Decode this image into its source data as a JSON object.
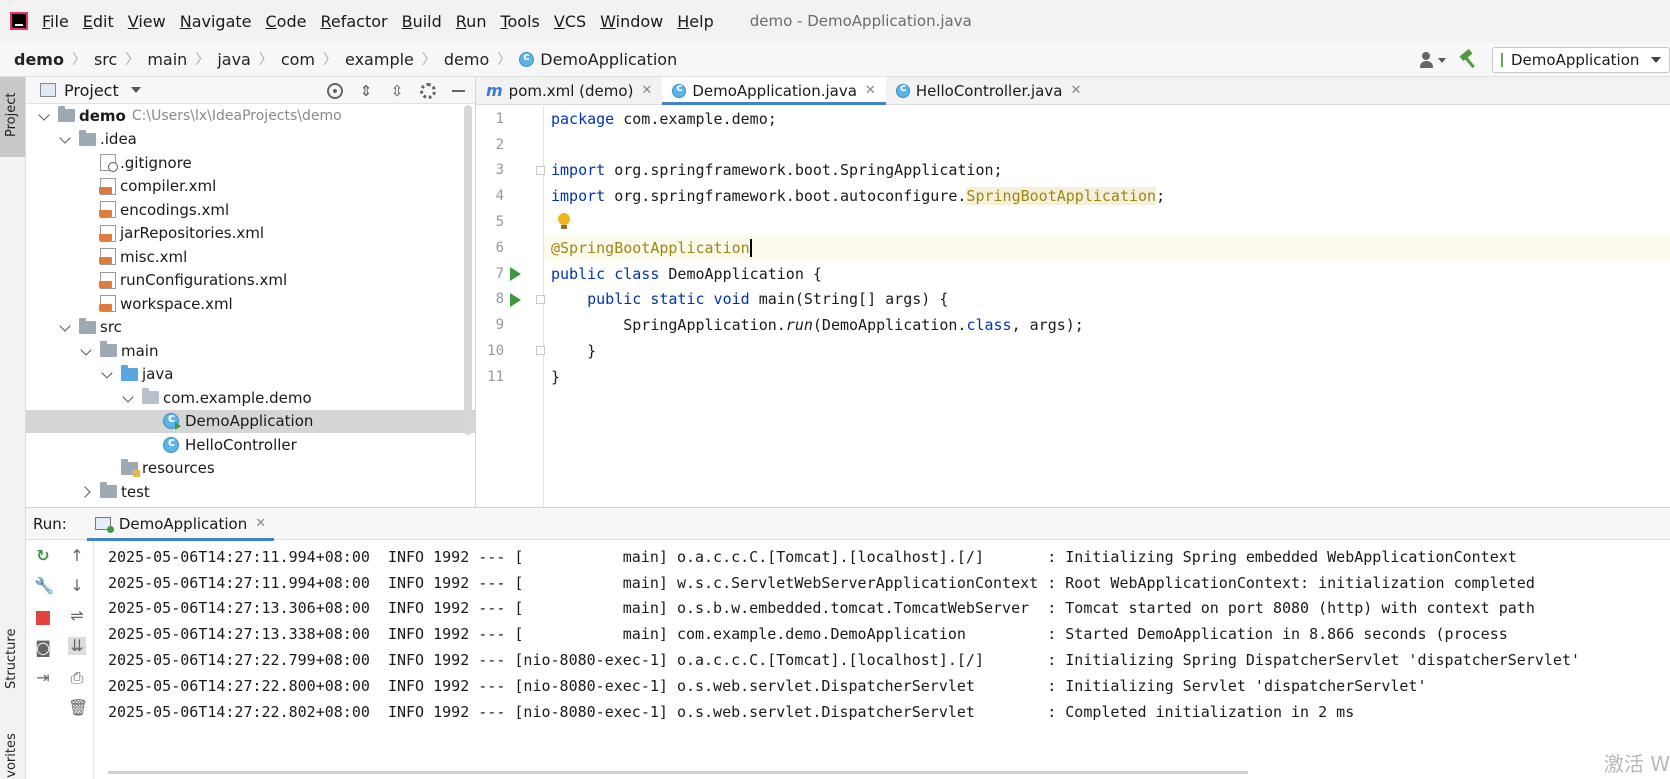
{
  "menubar": {
    "items": [
      {
        "label": "File",
        "ul": "F",
        "rest": "ile"
      },
      {
        "label": "Edit",
        "ul": "E",
        "rest": "dit"
      },
      {
        "label": "View",
        "ul": "V",
        "rest": "iew"
      },
      {
        "label": "Navigate",
        "ul": "N",
        "rest": "avigate"
      },
      {
        "label": "Code",
        "ul": "C",
        "rest": "ode"
      },
      {
        "label": "Refactor",
        "ul": "R",
        "rest": "efactor"
      },
      {
        "label": "Build",
        "ul": "B",
        "rest": "uild"
      },
      {
        "label": "Run",
        "ul": "R",
        "rest": "un"
      },
      {
        "label": "Tools",
        "ul": "T",
        "rest": "ools"
      },
      {
        "label": "VCS",
        "ul": "V",
        "rest": "CS"
      },
      {
        "label": "Window",
        "ul": "W",
        "rest": "indow"
      },
      {
        "label": "Help",
        "ul": "H",
        "rest": "elp"
      }
    ],
    "window_title": "demo - DemoApplication.java"
  },
  "breadcrumb": [
    "demo",
    "src",
    "main",
    "java",
    "com",
    "example",
    "demo",
    "DemoApplication"
  ],
  "run_config": {
    "label": "DemoApplication"
  },
  "left_strip": {
    "project": "Project",
    "structure": "Structure",
    "favorites": "Favorites"
  },
  "project_panel": {
    "title": "Project",
    "tree": [
      {
        "label": "demo",
        "path": "C:\\Users\\lx\\IdeaProjects\\demo",
        "depth": 0,
        "chev": "down",
        "icon": "folder",
        "bold": true
      },
      {
        "label": ".idea",
        "depth": 1,
        "chev": "down",
        "icon": "folder"
      },
      {
        "label": ".gitignore",
        "depth": 2,
        "chev": "none",
        "icon": "git"
      },
      {
        "label": "compiler.xml",
        "depth": 2,
        "chev": "none",
        "icon": "xml"
      },
      {
        "label": "encodings.xml",
        "depth": 2,
        "chev": "none",
        "icon": "xml"
      },
      {
        "label": "jarRepositories.xml",
        "depth": 2,
        "chev": "none",
        "icon": "xml"
      },
      {
        "label": "misc.xml",
        "depth": 2,
        "chev": "none",
        "icon": "xml"
      },
      {
        "label": "runConfigurations.xml",
        "depth": 2,
        "chev": "none",
        "icon": "xml"
      },
      {
        "label": "workspace.xml",
        "depth": 2,
        "chev": "none",
        "icon": "xml"
      },
      {
        "label": "src",
        "depth": 1,
        "chev": "down",
        "icon": "folder"
      },
      {
        "label": "main",
        "depth": 2,
        "chev": "down",
        "icon": "folder"
      },
      {
        "label": "java",
        "depth": 3,
        "chev": "down",
        "icon": "folder-blue"
      },
      {
        "label": "com.example.demo",
        "depth": 4,
        "chev": "down",
        "icon": "package"
      },
      {
        "label": "DemoApplication",
        "depth": 5,
        "chev": "none",
        "icon": "class-run",
        "selected": true
      },
      {
        "label": "HelloController",
        "depth": 5,
        "chev": "none",
        "icon": "class"
      },
      {
        "label": "resources",
        "depth": 3,
        "chev": "none",
        "icon": "resources"
      },
      {
        "label": "test",
        "depth": 2,
        "chev": "right",
        "icon": "folder"
      }
    ]
  },
  "editor": {
    "tabs": [
      {
        "label": "pom.xml (demo)",
        "icon": "maven",
        "active": false
      },
      {
        "label": "DemoApplication.java",
        "icon": "class",
        "active": true
      },
      {
        "label": "HelloController.java",
        "icon": "class",
        "active": false
      }
    ],
    "line_numbers": [
      "1",
      "2",
      "3",
      "4",
      "5",
      "6",
      "7",
      "8",
      "9",
      "10",
      "11"
    ],
    "code": {
      "l1_kw": "package",
      "l1_rest": " com.example.demo;",
      "l3_kw": "import",
      "l3_rest": " org.springframework.boot.SpringApplication;",
      "l4_kw": "import",
      "l4_rest": " org.springframework.boot.autoconfigure.",
      "l4_ann": "SpringBootApplication",
      "l4_end": ";",
      "l6_ann": "@SpringBootApplication",
      "l7_kw": "public class",
      "l7_rest": " DemoApplication {",
      "l8_indent": "    ",
      "l8_kw": "public static void",
      "l8_rest": " main(String[] args) {",
      "l9_indent": "        ",
      "l9_a": "SpringApplication.",
      "l9_italic": "run",
      "l9_b": "(DemoApplication.",
      "l9_kw": "class",
      "l9_c": ", args);",
      "l10": "    }",
      "l11": "}"
    }
  },
  "run_panel": {
    "label": "Run:",
    "tab": "DemoApplication",
    "logs": [
      "2025-05-06T14:27:11.994+08:00  INFO 1992 --- [           main] o.a.c.c.C.[Tomcat].[localhost].[/]       : Initializing Spring embedded WebApplicationContext",
      "2025-05-06T14:27:11.994+08:00  INFO 1992 --- [           main] w.s.c.ServletWebServerApplicationContext : Root WebApplicationContext: initialization completed",
      "2025-05-06T14:27:13.306+08:00  INFO 1992 --- [           main] o.s.b.w.embedded.tomcat.TomcatWebServer  : Tomcat started on port 8080 (http) with context path",
      "2025-05-06T14:27:13.338+08:00  INFO 1992 --- [           main] com.example.demo.DemoApplication         : Started DemoApplication in 8.866 seconds (process",
      "2025-05-06T14:27:22.799+08:00  INFO 1992 --- [nio-8080-exec-1] o.a.c.c.C.[Tomcat].[localhost].[/]       : Initializing Spring DispatcherServlet 'dispatcherServlet'",
      "2025-05-06T14:27:22.800+08:00  INFO 1992 --- [nio-8080-exec-1] o.s.web.servlet.DispatcherServlet        : Initializing Servlet 'dispatcherServlet'",
      "2025-05-06T14:27:22.802+08:00  INFO 1992 --- [nio-8080-exec-1] o.s.web.servlet.DispatcherServlet        : Completed initialization in 2 ms"
    ]
  },
  "watermark": "激活 W",
  "colors": {
    "keyword": "#0033b3",
    "annotation": "#9e880d",
    "run_green": "#3d9a3d",
    "stop_red": "#e0443e",
    "accent": "#4083c9"
  }
}
